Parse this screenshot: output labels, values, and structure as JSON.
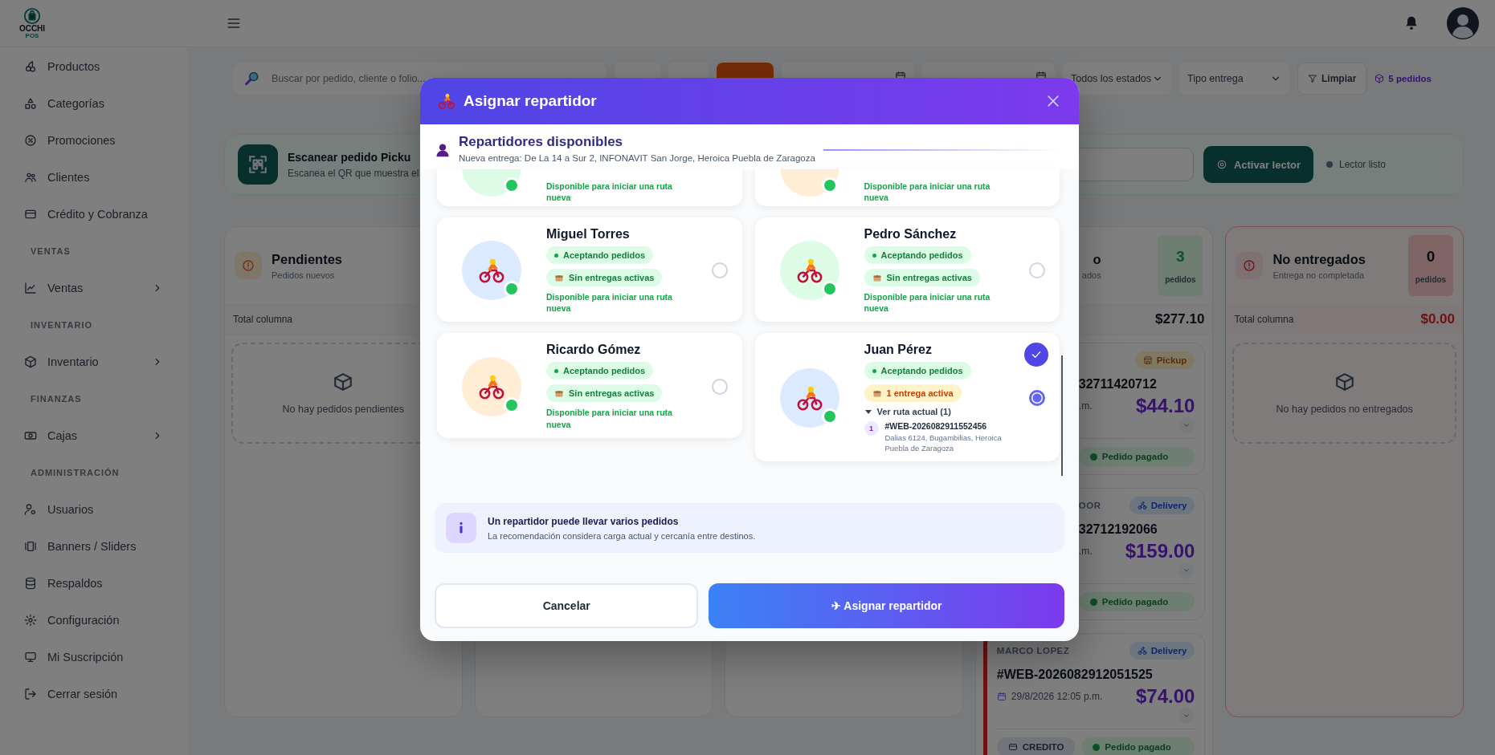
{
  "header": {
    "logo": {
      "name": "OCCHI",
      "tagline": "POS"
    }
  },
  "sidebar": {
    "items": [
      {
        "kind": "link",
        "label": "Productos",
        "submenu": false,
        "selected": false
      },
      {
        "kind": "link",
        "label": "Categorías",
        "submenu": false,
        "selected": false
      },
      {
        "kind": "link",
        "label": "Promociones",
        "submenu": false,
        "selected": false
      },
      {
        "kind": "link",
        "label": "Clientes",
        "submenu": false,
        "selected": false
      },
      {
        "kind": "link",
        "label": "Crédito y Cobranza",
        "submenu": false,
        "selected": false
      },
      {
        "kind": "section",
        "label": "VENTAS"
      },
      {
        "kind": "link",
        "label": "Ventas",
        "submenu": true,
        "selected": false
      },
      {
        "kind": "section",
        "label": "INVENTARIO"
      },
      {
        "kind": "link",
        "label": "Inventario",
        "submenu": true,
        "selected": false
      },
      {
        "kind": "section",
        "label": "FINANZAS"
      },
      {
        "kind": "link",
        "label": "Cajas",
        "submenu": true,
        "selected": false
      },
      {
        "kind": "section",
        "label": "ADMINISTRACIÓN"
      },
      {
        "kind": "link",
        "label": "Usuarios",
        "submenu": false,
        "selected": false
      },
      {
        "kind": "link",
        "label": "Banners / Sliders",
        "submenu": false,
        "selected": false
      },
      {
        "kind": "link",
        "label": "Respaldos",
        "submenu": false,
        "selected": false
      },
      {
        "kind": "link",
        "label": "Configuración",
        "submenu": false,
        "selected": false
      },
      {
        "kind": "link",
        "label": "Mi Suscripción",
        "submenu": false,
        "selected": false
      },
      {
        "kind": "link",
        "label": "Cerrar sesión",
        "submenu": false,
        "selected": false
      }
    ]
  },
  "toolbar": {
    "search": {
      "placeholder": "Buscar por pedido, cliente o folio..."
    },
    "controls": [
      {
        "kind": "button"
      },
      {
        "kind": "button"
      },
      {
        "kind": "accent"
      },
      {
        "kind": "date"
      },
      {
        "kind": "date"
      }
    ],
    "status_filter": "Todos los estados",
    "delivery_filter": "Tipo entrega",
    "clear": "Limpiar",
    "count": "5 pedidos"
  },
  "scanner": {
    "title": "Escanear pedido Picku",
    "subtitle": "Escanea el QR que muestra el",
    "button": "Activar lector",
    "status": "Lector listo"
  },
  "board": {
    "columns": [
      {
        "kind": "pending",
        "covered": false,
        "title": "Pendientes",
        "subtitle": "Pedidos nuevos",
        "total_label": "Total columna",
        "empty": "No hay pedidos pendientes"
      },
      {
        "kind": "hidden"
      },
      {
        "kind": "hidden"
      },
      {
        "kind": "ready",
        "covered": true,
        "title": "o",
        "subtitle": "ados",
        "count": "3",
        "count_label": "pedidos",
        "total": "$277.10",
        "orders": [
          {
            "kind": "pickup",
            "covered": true,
            "delivery_label": "Pickup",
            "id": "32711420712",
            "time": ".m.",
            "amount": "$44.10",
            "payment": "Pedido pagado",
            "overdue": false
          },
          {
            "kind": "delivery",
            "covered": true,
            "customer": "OOR",
            "delivery_label": "Delivery",
            "id": "32712192066",
            "time": ".m.",
            "amount": "$159.00",
            "payment": "Pedido pagado",
            "overdue": false
          },
          {
            "kind": "delivery",
            "covered": false,
            "customer": "MARCO LOPEZ",
            "delivery_label": "Delivery",
            "id": "#WEB-2026082912051525",
            "time": "29/8/2026 12:05 p.m.",
            "amount": "$74.00",
            "method": "CREDITO",
            "payment": "Pedido pagado",
            "overdue": true
          }
        ]
      },
      {
        "kind": "failed",
        "covered": false,
        "title": "No entregados",
        "subtitle": "Entrega no completada",
        "count": "0",
        "count_label": "pedidos",
        "total_label": "Total columna",
        "total": "$0.00",
        "empty": "No hay pedidos no entregados"
      }
    ]
  },
  "modal": {
    "title": "Asignar repartidor",
    "section_title": "Repartidores disponibles",
    "address": "Nueva entrega: De La 14 a Sur 2, INFONAVIT San Jorge, Heroica Puebla de Zaragoza",
    "couriers": [
      {
        "kind": "partial",
        "color": "#dcfce7",
        "online": true,
        "note": "Disponible para iniciar una ruta nueva"
      },
      {
        "kind": "partial",
        "color": "#ffedd5",
        "online": true,
        "note": "Disponible para iniciar una ruta nueva"
      },
      {
        "kind": "full",
        "name": "Miguel Torres",
        "color": "#dbeafe",
        "online": true,
        "status": "Aceptando pedidos",
        "load": "Sin entregas activas",
        "busy": false,
        "note": "Disponible para iniciar una ruta nueva",
        "selected": false
      },
      {
        "kind": "full",
        "name": "Pedro Sánchez",
        "color": "#dcfce7",
        "online": true,
        "status": "Aceptando pedidos",
        "load": "Sin entregas activas",
        "busy": false,
        "note": "Disponible para iniciar una ruta nueva",
        "selected": false
      },
      {
        "kind": "full",
        "name": "Ricardo Gómez",
        "color": "#ffedd5",
        "online": true,
        "status": "Aceptando pedidos",
        "load": "Sin entregas activas",
        "busy": false,
        "note": "Disponible para iniciar una ruta nueva",
        "selected": false
      },
      {
        "kind": "full",
        "name": "Juan Pérez",
        "color": "#dbeafe",
        "online": true,
        "status": "Aceptando pedidos",
        "load": "1 entrega activa",
        "busy": true,
        "selected": true,
        "route": {
          "label": "Ver ruta actual (1)",
          "expanded": true,
          "stops": [
            {
              "number": "1",
              "order": "#WEB-2026082911552456",
              "address": "Dalias 6124, Bugambilias, Heroica Puebla de Zaragoza"
            }
          ]
        }
      }
    ],
    "info": {
      "title": "Un repartidor puede llevar varios pedidos",
      "text": "La recomendación considera carga actual y cercanía entre destinos."
    },
    "cancel": "Cancelar",
    "confirm": "✈ Asignar repartidor"
  }
}
